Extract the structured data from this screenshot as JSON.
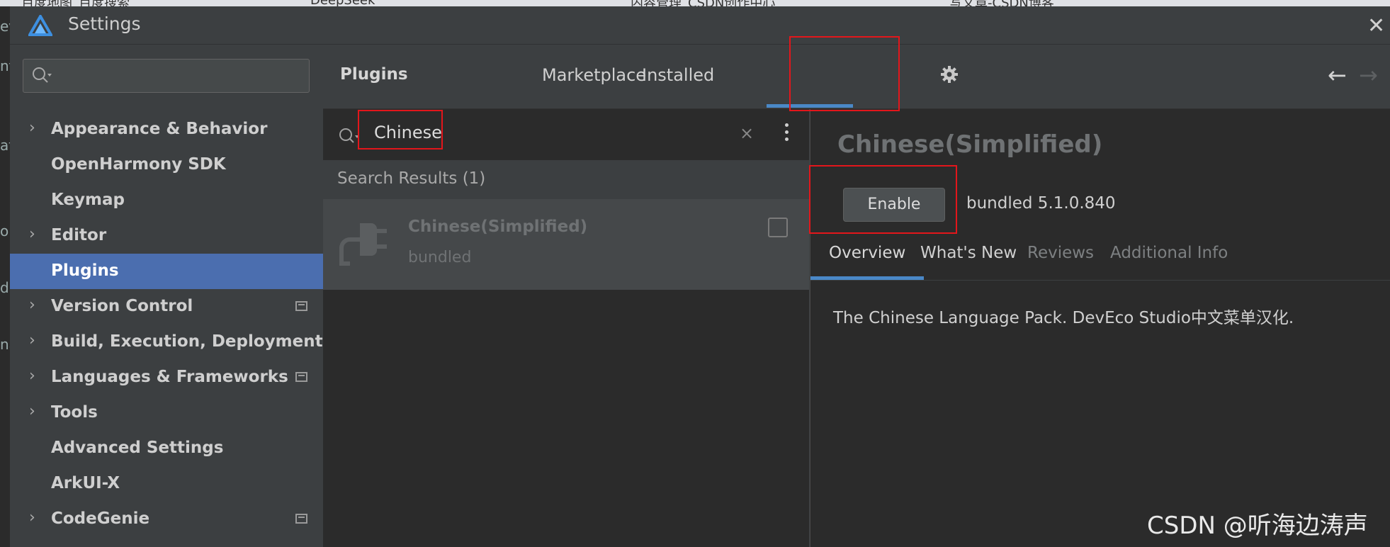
{
  "browser_tabs": [
    "百度地图_百度搜索",
    "DeepSeek",
    "内容管理_CSDN创作中心",
    "写文章-CSDN博客"
  ],
  "left_edge_fragments": [
    "ev",
    "nt",
    "at",
    "op",
    "d",
    "na"
  ],
  "window": {
    "title": "Settings",
    "close_icon": "close-icon"
  },
  "sidebar": {
    "search_placeholder": "",
    "items": [
      {
        "label": "Appearance & Behavior",
        "expandable": true,
        "badge": false,
        "active": false
      },
      {
        "label": "OpenHarmony SDK",
        "expandable": false,
        "badge": false,
        "active": false
      },
      {
        "label": "Keymap",
        "expandable": false,
        "badge": false,
        "active": false
      },
      {
        "label": "Editor",
        "expandable": true,
        "badge": false,
        "active": false
      },
      {
        "label": "Plugins",
        "expandable": false,
        "badge": false,
        "active": true
      },
      {
        "label": "Version Control",
        "expandable": true,
        "badge": true,
        "active": false
      },
      {
        "label": "Build, Execution, Deployment",
        "expandable": true,
        "badge": false,
        "active": false
      },
      {
        "label": "Languages & Frameworks",
        "expandable": true,
        "badge": true,
        "active": false
      },
      {
        "label": "Tools",
        "expandable": true,
        "badge": false,
        "active": false
      },
      {
        "label": "Advanced Settings",
        "expandable": false,
        "badge": false,
        "active": false
      },
      {
        "label": "ArkUI-X",
        "expandable": false,
        "badge": false,
        "active": false
      },
      {
        "label": "CodeGenie",
        "expandable": true,
        "badge": true,
        "active": false
      }
    ]
  },
  "header": {
    "title": "Plugins",
    "tabs": [
      {
        "label": "Marketplace",
        "selected": false
      },
      {
        "label": "Installed",
        "selected": true
      }
    ],
    "settings_icon": "gear-icon",
    "back_icon": "arrow-left-icon",
    "forward_icon": "arrow-right-icon"
  },
  "list": {
    "search_value": "Chinese",
    "clear_glyph": "×",
    "results_header": "Search Results (1)",
    "items": [
      {
        "name": "Chinese(Simplified)",
        "subtitle": "bundled",
        "checked": false
      }
    ]
  },
  "detail": {
    "title": "Chinese(Simplified)",
    "enable_label": "Enable",
    "version": "bundled 5.1.0.840",
    "tabs": [
      {
        "label": "Overview",
        "selected": true
      },
      {
        "label": "What's New",
        "selected": false
      },
      {
        "label": "Reviews",
        "selected": false
      },
      {
        "label": "Additional Info",
        "selected": false
      }
    ],
    "description": "The Chinese Language Pack. DevEco Studio中文菜单汉化."
  },
  "watermark": "CSDN @听海边涛声",
  "colors": {
    "accent": "#4a88c7",
    "active_nav": "#4b6eaf",
    "annotation": "#e3161b",
    "panel_dark": "#2b2b2b",
    "panel": "#3c3f41"
  }
}
